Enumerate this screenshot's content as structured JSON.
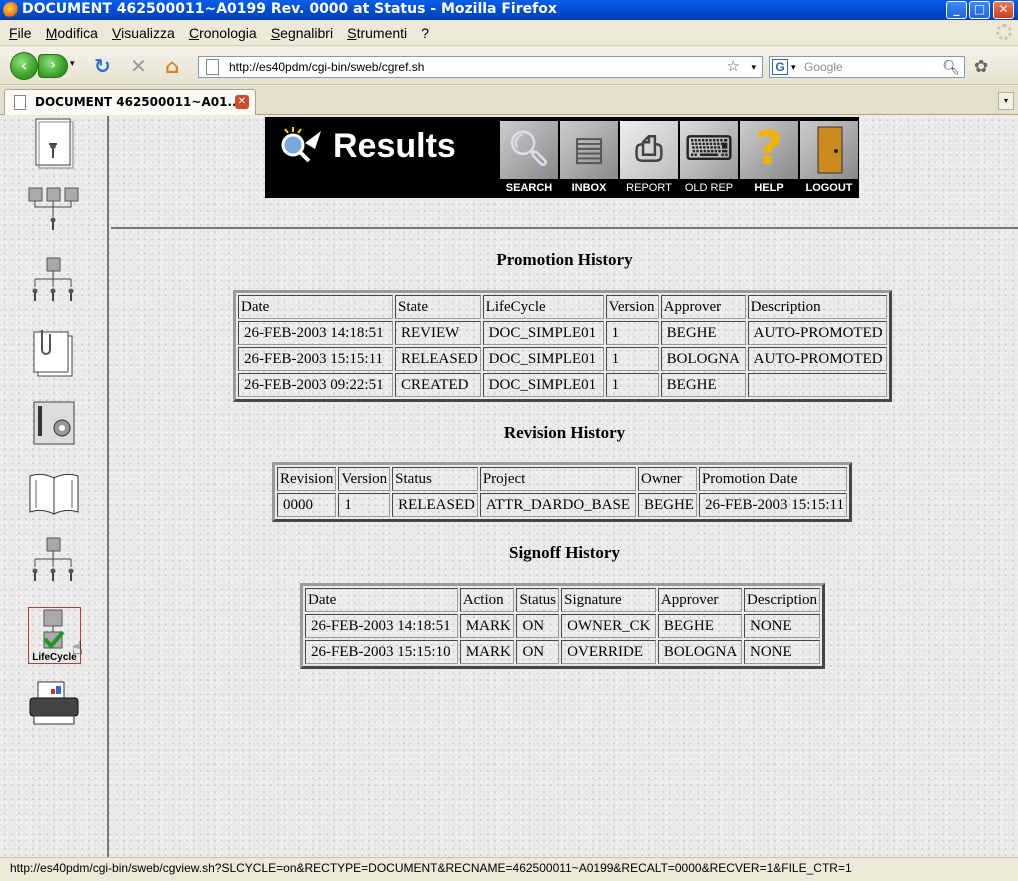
{
  "window": {
    "title": "DOCUMENT 462500011~A0199 Rev. 0000 at Status  - Mozilla Firefox"
  },
  "menu": [
    "File",
    "Modifica",
    "Visualizza",
    "Cronologia",
    "Segnalibri",
    "Strumenti",
    "?"
  ],
  "nav": {
    "url": "http://es40pdm/cgi-bin/sweb/cgref.sh",
    "search_placeholder": "Google"
  },
  "tab": {
    "title": "DOCUMENT 462500011~A01..."
  },
  "sidebar": {
    "lifecycle_label": "LifeCycle"
  },
  "banner": {
    "title": "Results",
    "buttons": [
      {
        "label": "SEARCH",
        "icon": "magnifier-icon"
      },
      {
        "label": "INBOX",
        "icon": "inbox-tray-icon"
      },
      {
        "label": "REPORT",
        "icon": "printer-icon"
      },
      {
        "label": "OLD REP",
        "icon": "typewriter-icon"
      },
      {
        "label": "HELP",
        "icon": "question-mark-icon"
      },
      {
        "label": "LOGOUT",
        "icon": "door-icon"
      }
    ]
  },
  "promotion": {
    "title": "Promotion History",
    "headers": [
      "Date",
      "State",
      "LifeCycle",
      "Version",
      "Approver",
      "Description"
    ],
    "rows": [
      [
        "26-FEB-2003 14:18:51",
        "REVIEW",
        "DOC_SIMPLE01",
        "1",
        "BEGHE",
        "AUTO-PROMOTED"
      ],
      [
        "26-FEB-2003 15:15:11",
        "RELEASED",
        "DOC_SIMPLE01",
        "1",
        "BOLOGNA",
        "AUTO-PROMOTED"
      ],
      [
        "26-FEB-2003 09:22:51",
        "CREATED",
        "DOC_SIMPLE01",
        "1",
        "BEGHE",
        ""
      ]
    ]
  },
  "revision": {
    "title": "Revision History",
    "headers": [
      "Revision",
      "Version",
      "Status",
      "Project",
      "Owner",
      "Promotion Date"
    ],
    "rows": [
      [
        "0000",
        "1",
        "RELEASED",
        "ATTR_DARDO_BASE",
        "BEGHE",
        "26-FEB-2003 15:15:11"
      ]
    ]
  },
  "signoff": {
    "title": "Signoff History",
    "headers": [
      "Date",
      "Action",
      "Status",
      "Signature",
      "Approver",
      "Description"
    ],
    "rows": [
      [
        "26-FEB-2003 14:18:51",
        "MARK",
        "ON",
        "OWNER_CK",
        "BEGHE",
        "NONE"
      ],
      [
        "26-FEB-2003 15:15:10",
        "MARK",
        "ON",
        "OVERRIDE",
        "BOLOGNA",
        "NONE"
      ]
    ]
  },
  "status": {
    "text": "http://es40pdm/cgi-bin/sweb/cgview.sh?SLCYCLE=on&RECTYPE=DOCUMENT&RECNAME=462500011~A0199&RECALT=0000&RECVER=1&FILE_CTR=1"
  }
}
